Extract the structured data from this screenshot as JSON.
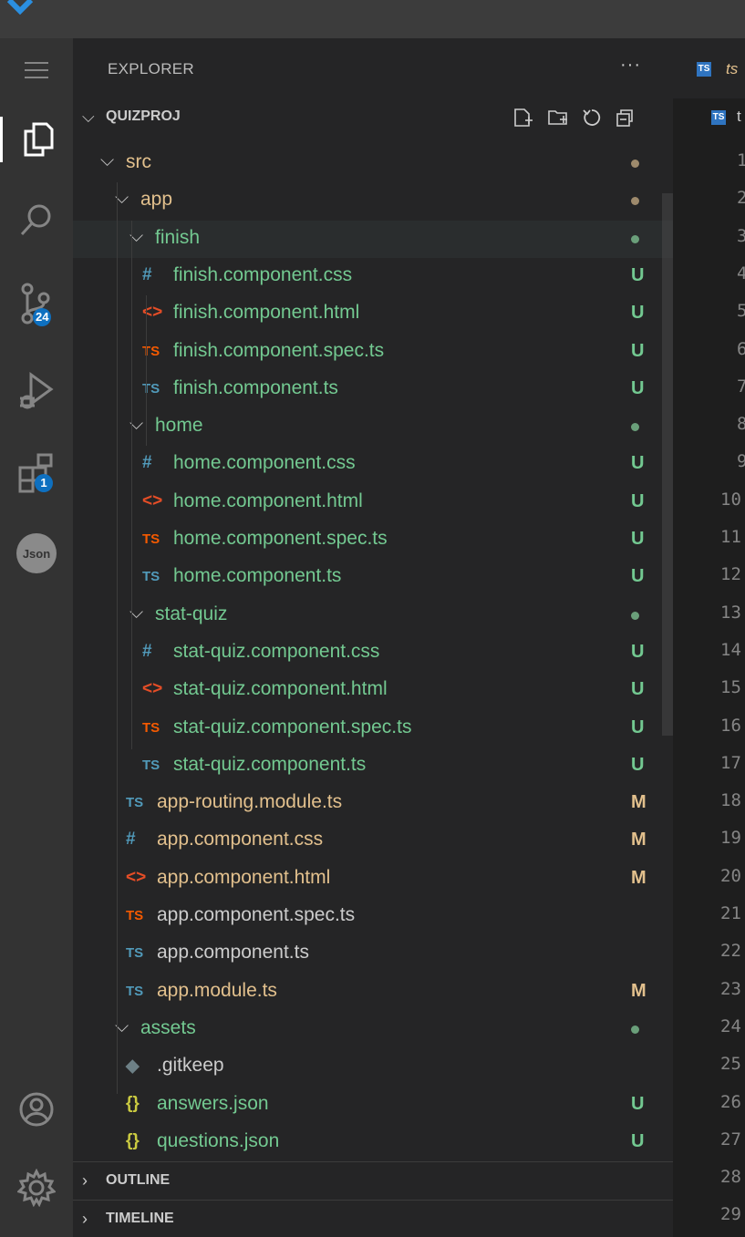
{
  "colors": {
    "green": "#73c991",
    "orange": "#e2c08d",
    "folder_dot_brown": "#9e8a6c",
    "folder_dot_green": "#6a9f7a",
    "css_icon": "#519aba",
    "html_icon": "#e44d26",
    "spec_icon": "#f55a00",
    "ts_icon": "#519aba",
    "json_icon": "#cbcb41"
  },
  "activity_bar": {
    "items": [
      {
        "name": "menu-icon"
      },
      {
        "name": "explorer-icon"
      },
      {
        "name": "search-icon"
      },
      {
        "name": "source-control-icon",
        "badge": "24"
      },
      {
        "name": "run-debug-icon"
      },
      {
        "name": "extensions-icon",
        "badge": "1"
      },
      {
        "name": "json-extension-icon",
        "label": "Json"
      },
      {
        "name": "accounts-icon"
      },
      {
        "name": "settings-gear-icon"
      }
    ]
  },
  "explorer": {
    "title": "EXPLORER",
    "more": "···",
    "project": "QUIZPROJ",
    "toolbar": [
      "new-file-icon",
      "new-folder-icon",
      "refresh-icon",
      "collapse-all-icon"
    ],
    "tree": [
      {
        "type": "folder",
        "name": "src",
        "depth": 0,
        "dot": "brown"
      },
      {
        "type": "folder",
        "name": "app",
        "depth": 1,
        "dot": "brown"
      },
      {
        "type": "folder",
        "name": "finish",
        "depth": 2,
        "dot": "green",
        "selected": true
      },
      {
        "type": "file",
        "icon": "#",
        "kind": "css",
        "name": "finish.component.css",
        "depth": 3,
        "status": "U"
      },
      {
        "type": "file",
        "icon": "<>",
        "kind": "html",
        "name": "finish.component.html",
        "depth": 3,
        "status": "U"
      },
      {
        "type": "file",
        "icon": "TS",
        "kind": "spec",
        "name": "finish.component.spec.ts",
        "depth": 3,
        "status": "U"
      },
      {
        "type": "file",
        "icon": "TS",
        "kind": "ts",
        "name": "finish.component.ts",
        "depth": 3,
        "status": "U"
      },
      {
        "type": "folder",
        "name": "home",
        "depth": 2,
        "dot": "green"
      },
      {
        "type": "file",
        "icon": "#",
        "kind": "css",
        "name": "home.component.css",
        "depth": 3,
        "status": "U"
      },
      {
        "type": "file",
        "icon": "<>",
        "kind": "html",
        "name": "home.component.html",
        "depth": 3,
        "status": "U"
      },
      {
        "type": "file",
        "icon": "TS",
        "kind": "spec",
        "name": "home.component.spec.ts",
        "depth": 3,
        "status": "U"
      },
      {
        "type": "file",
        "icon": "TS",
        "kind": "ts",
        "name": "home.component.ts",
        "depth": 3,
        "status": "U"
      },
      {
        "type": "folder",
        "name": "stat-quiz",
        "depth": 2,
        "dot": "green"
      },
      {
        "type": "file",
        "icon": "#",
        "kind": "css",
        "name": "stat-quiz.component.css",
        "depth": 3,
        "status": "U"
      },
      {
        "type": "file",
        "icon": "<>",
        "kind": "html",
        "name": "stat-quiz.component.html",
        "depth": 3,
        "status": "U"
      },
      {
        "type": "file",
        "icon": "TS",
        "kind": "spec",
        "name": "stat-quiz.component.spec.ts",
        "depth": 3,
        "status": "U"
      },
      {
        "type": "file",
        "icon": "TS",
        "kind": "ts",
        "name": "stat-quiz.component.ts",
        "depth": 3,
        "status": "U"
      },
      {
        "type": "file",
        "icon": "TS",
        "kind": "ts",
        "name": "app-routing.module.ts",
        "depth": 2,
        "status": "M"
      },
      {
        "type": "file",
        "icon": "#",
        "kind": "css",
        "name": "app.component.css",
        "depth": 2,
        "status": "M"
      },
      {
        "type": "file",
        "icon": "<>",
        "kind": "html",
        "name": "app.component.html",
        "depth": 2,
        "status": "M"
      },
      {
        "type": "file",
        "icon": "TS",
        "kind": "spec",
        "name": "app.component.spec.ts",
        "depth": 2,
        "status": ""
      },
      {
        "type": "file",
        "icon": "TS",
        "kind": "ts",
        "name": "app.component.ts",
        "depth": 2,
        "status": ""
      },
      {
        "type": "file",
        "icon": "TS",
        "kind": "ts",
        "name": "app.module.ts",
        "depth": 2,
        "status": "M"
      },
      {
        "type": "folder",
        "name": "assets",
        "depth": 1,
        "dot": "green"
      },
      {
        "type": "file",
        "icon": "◆",
        "kind": "git",
        "name": ".gitkeep",
        "depth": 2,
        "status": ""
      },
      {
        "type": "file",
        "icon": "{}",
        "kind": "json",
        "name": "answers.json",
        "depth": 2,
        "status": "U"
      },
      {
        "type": "file",
        "icon": "{}",
        "kind": "json",
        "name": "questions.json",
        "depth": 2,
        "status": "U"
      }
    ],
    "sections": [
      {
        "label": "OUTLINE"
      },
      {
        "label": "TIMELINE"
      }
    ]
  },
  "editor": {
    "tab_icon": "TS",
    "tab_label": "ts",
    "breadcrumb_label": "t",
    "line_numbers": [
      "1",
      "2",
      "3",
      "4",
      "5",
      "6",
      "7",
      "8",
      "9",
      "10",
      "11",
      "12",
      "13",
      "14",
      "15",
      "16",
      "17",
      "18",
      "19",
      "20",
      "21",
      "22",
      "23",
      "24",
      "25",
      "26",
      "27",
      "28",
      "29"
    ]
  }
}
